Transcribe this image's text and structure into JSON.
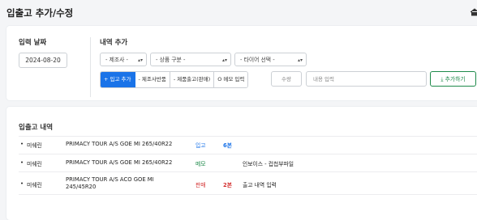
{
  "page": {
    "title": "입출고 추가/수정"
  },
  "form": {
    "date_label": "입력 날짜",
    "date_value": "2024-08-20",
    "entry_label": "내역 추가",
    "selects": {
      "manufacturer": "- 제조사 -",
      "product_category": "- 상품 구분 -",
      "tire": "- 타이어 선택 -"
    },
    "type_buttons": [
      {
        "label": "+ 입고 추가",
        "active": true
      },
      {
        "label": "- 제조사반품",
        "active": false
      },
      {
        "label": "- 제품출고(판매)",
        "active": false
      },
      {
        "label": "O 메모 입력",
        "active": false
      }
    ],
    "quantity_placeholder": "수량",
    "content_placeholder": "내용 입력",
    "add_button": "추가하기"
  },
  "history": {
    "title": "입출고 내역",
    "rows": [
      {
        "brand": "미쉐린",
        "product": "PRIMACY TOUR A/S GOE MI 265/40R22",
        "type": "입고",
        "type_kind": "in",
        "qty": "6본",
        "note": ""
      },
      {
        "brand": "미쉐린",
        "product": "PRIMACY TOUR A/S GOE MI 265/40R22",
        "type": "메모",
        "type_kind": "memo",
        "qty": "",
        "note": "인보이스 - 컵첩부파일"
      },
      {
        "brand": "미쉐린",
        "product": "PRIMACY TOUR A/S ACO GOE MI 245/45R20",
        "type": "판매",
        "type_kind": "sale",
        "qty": "2본",
        "note": "출고 내역 입력"
      }
    ]
  },
  "colors": {
    "accent": "#1a73e8",
    "success": "#1e8a4a",
    "danger": "#d32f2f"
  }
}
